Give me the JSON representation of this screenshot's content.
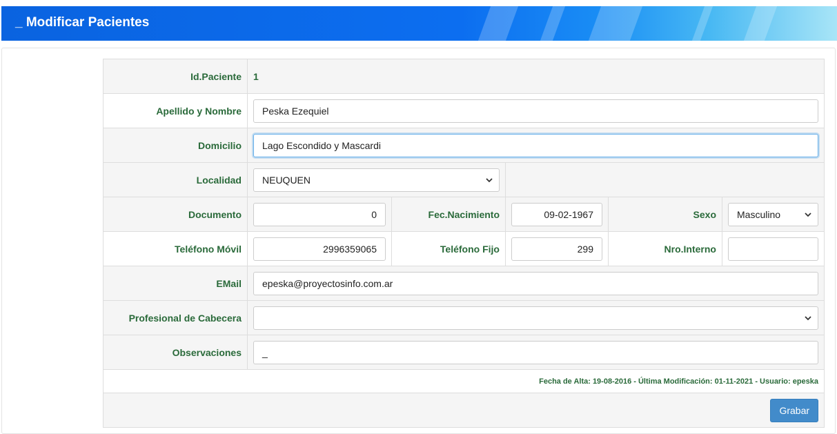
{
  "header": {
    "title": "_ Modificar Pacientes"
  },
  "form": {
    "id_label": "Id.Paciente",
    "id_value": "1",
    "name_label": "Apellido y Nombre",
    "name_value": "Peska Ezequiel",
    "address_label": "Domicilio",
    "address_value": "Lago Escondido y Mascardi",
    "city_label": "Localidad",
    "city_value": "NEUQUEN",
    "doc_label": "Documento",
    "doc_value": "0",
    "birth_label": "Fec.Nacimiento",
    "birth_value": "09-02-1967",
    "sex_label": "Sexo",
    "sex_value": "Masculino",
    "mobile_label": "Teléfono Móvil",
    "mobile_value": "2996359065",
    "phone_label": "Teléfono Fijo",
    "phone_value": "299",
    "ext_label": "Nro.Interno",
    "ext_value": "",
    "email_label": "EMail",
    "email_value": "epeska@proyectosinfo.com.ar",
    "doctor_label": "Profesional de Cabecera",
    "doctor_value": "",
    "notes_label": "Observaciones",
    "notes_value": "_"
  },
  "meta": {
    "audit": "Fecha de Alta: 19-08-2016 - Última Modificación: 01-11-2021 - Usuario: epeska"
  },
  "actions": {
    "save_label": "Grabar"
  }
}
